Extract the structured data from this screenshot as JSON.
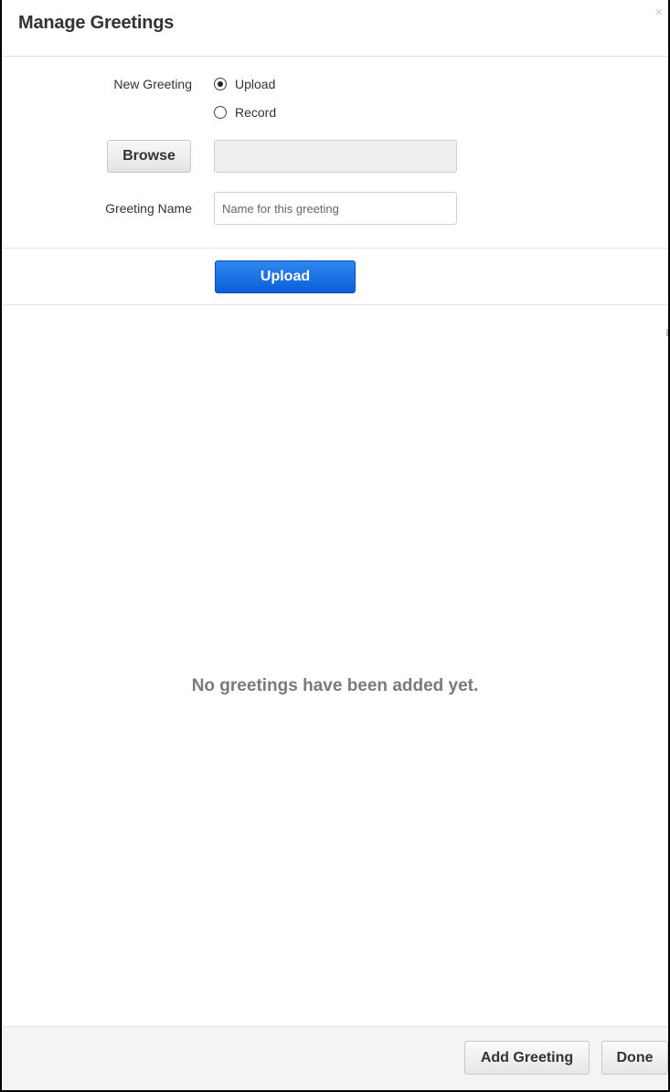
{
  "dialog": {
    "title": "Manage Greetings",
    "close_glyph": "×"
  },
  "form": {
    "new_greeting_label": "New Greeting",
    "options": [
      {
        "label": "Upload",
        "selected": true
      },
      {
        "label": "Record",
        "selected": false
      }
    ],
    "browse_label": "Browse",
    "file_value": "",
    "greeting_name_label": "Greeting Name",
    "greeting_name_value": "",
    "greeting_name_placeholder": "Name for this greeting",
    "upload_label": "Upload"
  },
  "list": {
    "empty_message": "No greetings have been added yet."
  },
  "footer": {
    "add_greeting_label": "Add Greeting",
    "done_label": "Done"
  },
  "colors": {
    "primary_button": "#0b5fd6",
    "empty_text": "#7a7a7a"
  },
  "icons": {
    "close": "close-icon",
    "radio_selected": "radio-selected-icon",
    "radio_unselected": "radio-unselected-icon"
  }
}
